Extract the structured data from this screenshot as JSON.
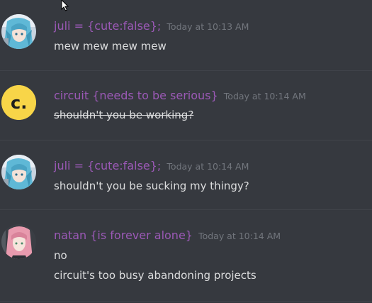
{
  "messages": [
    {
      "username": "juli = {cute:false};",
      "timestamp": "Today at 10:13 AM",
      "lines": [
        "mew mew mew mew"
      ],
      "avatar": "anime-girl-blue-hair-avatar"
    },
    {
      "username": "circuit {needs to be serious}",
      "timestamp": "Today at 10:14 AM",
      "lines": [
        "shouldn't you be working?"
      ],
      "strikethrough": true,
      "avatar": "yellow-c-logo-avatar",
      "avatar_letter": "c."
    },
    {
      "username": "juli = {cute:false};",
      "timestamp": "Today at 10:14 AM",
      "lines": [
        "shouldn't you be sucking my thingy?"
      ],
      "avatar": "anime-girl-blue-hair-avatar"
    },
    {
      "username": "natan {is forever alone}",
      "timestamp": "Today at 10:14 AM",
      "lines": [
        "no",
        "circuit's too busy abandoning projects"
      ],
      "avatar": "anime-girl-pink-hair-avatar"
    }
  ],
  "colors": {
    "background": "#36393f",
    "username": "#9b59b6",
    "timestamp": "#72767d",
    "message_text": "#dcddde",
    "logo_yellow": "#f8d548"
  }
}
